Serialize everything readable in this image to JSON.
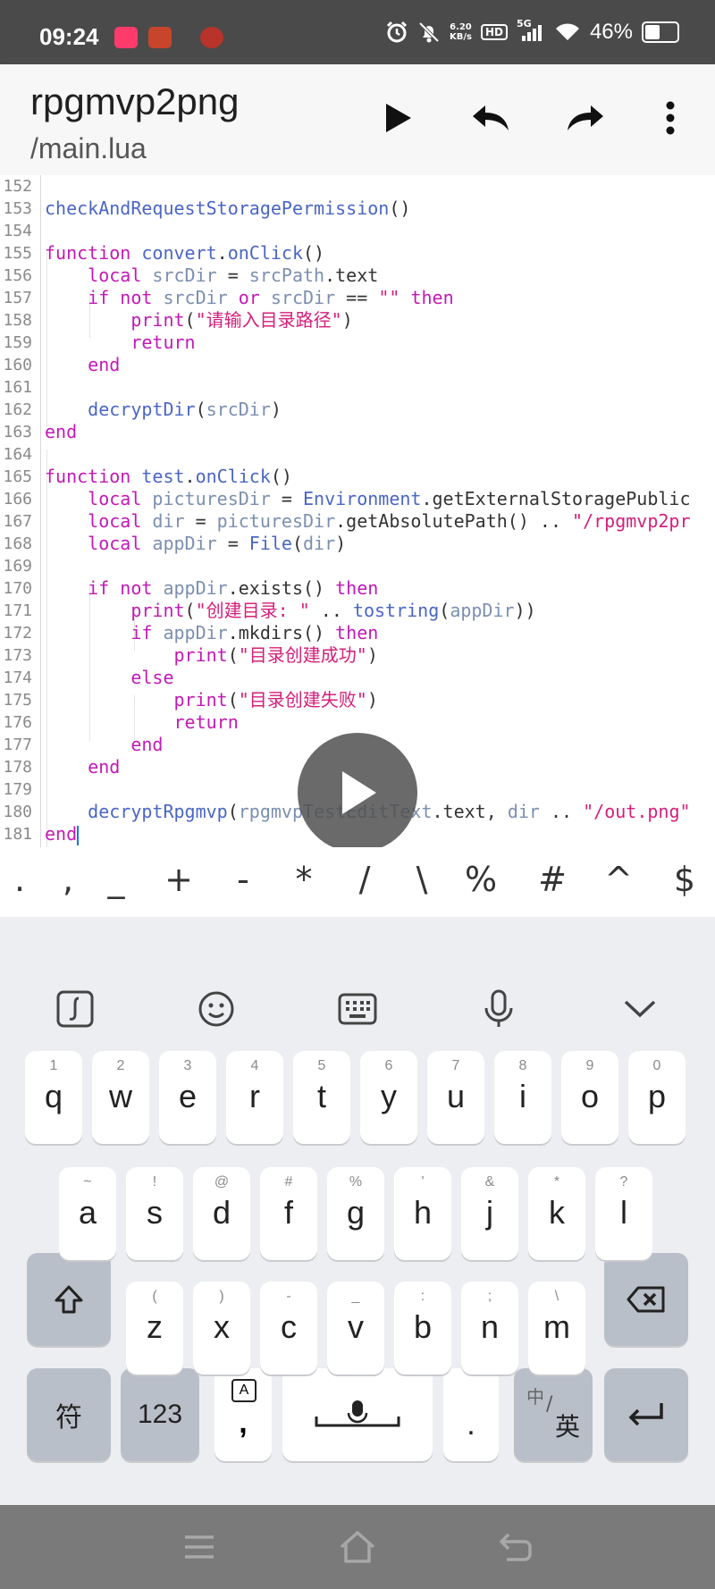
{
  "status_bar": {
    "time": "09:24",
    "net_speed_value": "6.20",
    "net_speed_unit": "KB/s",
    "hd_label": "HD",
    "network_label": "5G",
    "battery_text": "46%",
    "battery_level": 0.46
  },
  "app_bar": {
    "title": "rpgmvp2png",
    "subtitle": "/main.lua",
    "icons": [
      "play-icon",
      "undo-icon",
      "redo-icon",
      "more-vert-icon"
    ]
  },
  "editor": {
    "lines": [
      {
        "n": "152",
        "tokens": []
      },
      {
        "n": "153",
        "tokens": [
          {
            "c": "fn",
            "t": "checkAndRequestStoragePermission"
          },
          {
            "c": "pl",
            "t": "()"
          }
        ]
      },
      {
        "n": "154",
        "tokens": []
      },
      {
        "n": "155",
        "tokens": [
          {
            "c": "kw",
            "t": "function "
          },
          {
            "c": "fn",
            "t": "convert"
          },
          {
            "c": "pl",
            "t": "."
          },
          {
            "c": "fn",
            "t": "onClick"
          },
          {
            "c": "pl",
            "t": "()"
          }
        ]
      },
      {
        "n": "156",
        "tokens": [
          {
            "c": "pl",
            "t": "    "
          },
          {
            "c": "kw",
            "t": "local "
          },
          {
            "c": "vr",
            "t": "srcDir"
          },
          {
            "c": "pl",
            "t": " = "
          },
          {
            "c": "vr",
            "t": "srcPath"
          },
          {
            "c": "pl",
            "t": ".text"
          }
        ]
      },
      {
        "n": "157",
        "tokens": [
          {
            "c": "pl",
            "t": "    "
          },
          {
            "c": "kw",
            "t": "if not "
          },
          {
            "c": "vr",
            "t": "srcDir"
          },
          {
            "c": "kw",
            "t": " or "
          },
          {
            "c": "vr",
            "t": "srcDir"
          },
          {
            "c": "pl",
            "t": " == "
          },
          {
            "c": "st",
            "t": "\"\""
          },
          {
            "c": "kw",
            "t": " then"
          }
        ]
      },
      {
        "n": "158",
        "tokens": [
          {
            "c": "pl",
            "t": "        "
          },
          {
            "c": "kw",
            "t": "print"
          },
          {
            "c": "pl",
            "t": "("
          },
          {
            "c": "st",
            "t": "\"请输入目录路径\""
          },
          {
            "c": "pl",
            "t": ")"
          }
        ]
      },
      {
        "n": "159",
        "tokens": [
          {
            "c": "pl",
            "t": "        "
          },
          {
            "c": "kw",
            "t": "return"
          }
        ]
      },
      {
        "n": "160",
        "tokens": [
          {
            "c": "pl",
            "t": "    "
          },
          {
            "c": "kw",
            "t": "end"
          }
        ]
      },
      {
        "n": "161",
        "tokens": []
      },
      {
        "n": "162",
        "tokens": [
          {
            "c": "pl",
            "t": "    "
          },
          {
            "c": "fn",
            "t": "decryptDir"
          },
          {
            "c": "pl",
            "t": "("
          },
          {
            "c": "vr",
            "t": "srcDir"
          },
          {
            "c": "pl",
            "t": ")"
          }
        ]
      },
      {
        "n": "163",
        "tokens": [
          {
            "c": "kw",
            "t": "end"
          }
        ]
      },
      {
        "n": "164",
        "tokens": []
      },
      {
        "n": "165",
        "tokens": [
          {
            "c": "kw",
            "t": "function "
          },
          {
            "c": "fn",
            "t": "test"
          },
          {
            "c": "pl",
            "t": "."
          },
          {
            "c": "fn",
            "t": "onClick"
          },
          {
            "c": "pl",
            "t": "()"
          }
        ]
      },
      {
        "n": "166",
        "tokens": [
          {
            "c": "pl",
            "t": "    "
          },
          {
            "c": "kw",
            "t": "local "
          },
          {
            "c": "vr",
            "t": "picturesDir"
          },
          {
            "c": "pl",
            "t": " = "
          },
          {
            "c": "fn",
            "t": "Environment"
          },
          {
            "c": "pl",
            "t": ".getExternalStoragePublic"
          }
        ]
      },
      {
        "n": "167",
        "tokens": [
          {
            "c": "pl",
            "t": "    "
          },
          {
            "c": "kw",
            "t": "local "
          },
          {
            "c": "vr",
            "t": "dir"
          },
          {
            "c": "pl",
            "t": " = "
          },
          {
            "c": "vr",
            "t": "picturesDir"
          },
          {
            "c": "pl",
            "t": ".getAbsolutePath() .. "
          },
          {
            "c": "st",
            "t": "\"/rpgmvp2pr"
          }
        ]
      },
      {
        "n": "168",
        "tokens": [
          {
            "c": "pl",
            "t": "    "
          },
          {
            "c": "kw",
            "t": "local "
          },
          {
            "c": "vr",
            "t": "appDir"
          },
          {
            "c": "pl",
            "t": " = "
          },
          {
            "c": "fn",
            "t": "File"
          },
          {
            "c": "pl",
            "t": "("
          },
          {
            "c": "vr",
            "t": "dir"
          },
          {
            "c": "pl",
            "t": ")"
          }
        ]
      },
      {
        "n": "169",
        "tokens": []
      },
      {
        "n": "170",
        "tokens": [
          {
            "c": "pl",
            "t": "    "
          },
          {
            "c": "kw",
            "t": "if not "
          },
          {
            "c": "vr",
            "t": "appDir"
          },
          {
            "c": "pl",
            "t": ".exists() "
          },
          {
            "c": "kw",
            "t": "then"
          }
        ]
      },
      {
        "n": "171",
        "tokens": [
          {
            "c": "pl",
            "t": "        "
          },
          {
            "c": "kw",
            "t": "print"
          },
          {
            "c": "pl",
            "t": "("
          },
          {
            "c": "st",
            "t": "\"创建目录: \""
          },
          {
            "c": "pl",
            "t": " .. "
          },
          {
            "c": "fn",
            "t": "tostring"
          },
          {
            "c": "pl",
            "t": "("
          },
          {
            "c": "vr",
            "t": "appDir"
          },
          {
            "c": "pl",
            "t": "))"
          }
        ]
      },
      {
        "n": "172",
        "tokens": [
          {
            "c": "pl",
            "t": "        "
          },
          {
            "c": "kw",
            "t": "if "
          },
          {
            "c": "vr",
            "t": "appDir"
          },
          {
            "c": "pl",
            "t": ".mkdirs() "
          },
          {
            "c": "kw",
            "t": "then"
          }
        ]
      },
      {
        "n": "173",
        "tokens": [
          {
            "c": "pl",
            "t": "            "
          },
          {
            "c": "kw",
            "t": "print"
          },
          {
            "c": "pl",
            "t": "("
          },
          {
            "c": "st",
            "t": "\"目录创建成功\""
          },
          {
            "c": "pl",
            "t": ")"
          }
        ]
      },
      {
        "n": "174",
        "tokens": [
          {
            "c": "pl",
            "t": "        "
          },
          {
            "c": "kw",
            "t": "else"
          }
        ]
      },
      {
        "n": "175",
        "tokens": [
          {
            "c": "pl",
            "t": "            "
          },
          {
            "c": "kw",
            "t": "print"
          },
          {
            "c": "pl",
            "t": "("
          },
          {
            "c": "st",
            "t": "\"目录创建失败\""
          },
          {
            "c": "pl",
            "t": ")"
          }
        ]
      },
      {
        "n": "176",
        "tokens": [
          {
            "c": "pl",
            "t": "            "
          },
          {
            "c": "kw",
            "t": "return"
          }
        ]
      },
      {
        "n": "177",
        "tokens": [
          {
            "c": "pl",
            "t": "        "
          },
          {
            "c": "kw",
            "t": "end"
          }
        ]
      },
      {
        "n": "178",
        "tokens": [
          {
            "c": "pl",
            "t": "    "
          },
          {
            "c": "kw",
            "t": "end"
          }
        ]
      },
      {
        "n": "179",
        "tokens": []
      },
      {
        "n": "180",
        "tokens": [
          {
            "c": "pl",
            "t": "    "
          },
          {
            "c": "fn",
            "t": "decryptRpgmvp"
          },
          {
            "c": "pl",
            "t": "("
          },
          {
            "c": "vr",
            "t": "rpgmvpTestEditText"
          },
          {
            "c": "pl",
            "t": ".text, "
          },
          {
            "c": "vr",
            "t": "dir"
          },
          {
            "c": "pl",
            "t": " .. "
          },
          {
            "c": "st",
            "t": "\"/out.png\""
          }
        ]
      },
      {
        "n": "181",
        "tokens": [
          {
            "c": "kw",
            "t": "end"
          }
        ],
        "cursor": true
      }
    ]
  },
  "symbol_bar": [
    ".",
    ",",
    "_",
    "+",
    "-",
    "*",
    "/",
    "\\",
    "%",
    "#",
    "^",
    "$"
  ],
  "keyboard": {
    "toolbar_icons": [
      "handwriting-icon",
      "emoji-icon",
      "keyboard-icon",
      "microphone-icon",
      "chevron-down-icon"
    ],
    "row1": [
      {
        "letter": "q",
        "hint": "1"
      },
      {
        "letter": "w",
        "hint": "2"
      },
      {
        "letter": "e",
        "hint": "3"
      },
      {
        "letter": "r",
        "hint": "4"
      },
      {
        "letter": "t",
        "hint": "5"
      },
      {
        "letter": "y",
        "hint": "6"
      },
      {
        "letter": "u",
        "hint": "7"
      },
      {
        "letter": "i",
        "hint": "8"
      },
      {
        "letter": "o",
        "hint": "9"
      },
      {
        "letter": "p",
        "hint": "0"
      }
    ],
    "row2": [
      {
        "letter": "a",
        "hint": "~"
      },
      {
        "letter": "s",
        "hint": "!"
      },
      {
        "letter": "d",
        "hint": "@"
      },
      {
        "letter": "f",
        "hint": "#"
      },
      {
        "letter": "g",
        "hint": "%"
      },
      {
        "letter": "h",
        "hint": "'"
      },
      {
        "letter": "j",
        "hint": "&"
      },
      {
        "letter": "k",
        "hint": "*"
      },
      {
        "letter": "l",
        "hint": "?"
      }
    ],
    "row3": [
      {
        "letter": "z",
        "hint": "("
      },
      {
        "letter": "x",
        "hint": ")"
      },
      {
        "letter": "c",
        "hint": "-"
      },
      {
        "letter": "v",
        "hint": "_"
      },
      {
        "letter": "b",
        "hint": ":"
      },
      {
        "letter": "n",
        "hint": ";"
      },
      {
        "letter": "m",
        "hint": "\\"
      }
    ],
    "symbols_key": "符",
    "numbers_key": "123",
    "comma_key": ",",
    "comma_hint": "A",
    "period_key": ".",
    "lang_key_top": "中",
    "lang_key_bottom": "英"
  },
  "nav_bar": {
    "icons": [
      "menu-icon",
      "home-icon",
      "back-icon"
    ]
  }
}
